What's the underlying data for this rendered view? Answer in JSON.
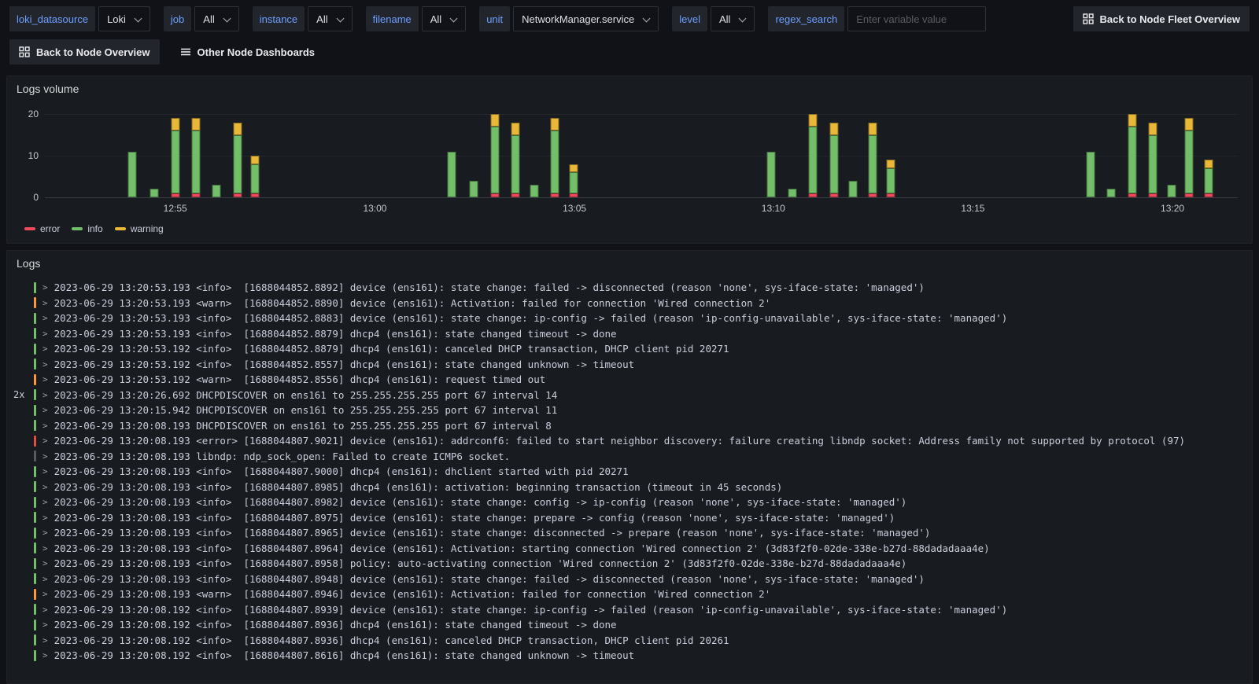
{
  "toolbar": {
    "variables": [
      {
        "label": "loki_datasource",
        "value": "Loki"
      },
      {
        "label": "job",
        "value": "All"
      },
      {
        "label": "instance",
        "value": "All"
      },
      {
        "label": "filename",
        "value": "All"
      },
      {
        "label": "unit",
        "value": "NetworkManager.service"
      },
      {
        "label": "level",
        "value": "All"
      }
    ],
    "regex_search": {
      "label": "regex_search",
      "placeholder": "Enter variable value"
    },
    "back_fleet_button": "Back to Node Fleet Overview"
  },
  "nav_row": {
    "back_node_button": "Back to Node Overview",
    "other_dashboards": "Other Node Dashboards"
  },
  "logs_volume_panel": {
    "title": "Logs volume"
  },
  "chart_data": {
    "type": "bar",
    "stacked": true,
    "title": "Logs volume",
    "ylim": [
      0,
      20
    ],
    "yticks": [
      0,
      10,
      20
    ],
    "grid": true,
    "legend_position": "bottom-left",
    "series_order": [
      "error",
      "info",
      "warning"
    ],
    "legend": [
      {
        "label": "error",
        "color": "#f2495c"
      },
      {
        "label": "info",
        "color": "#73bf69"
      },
      {
        "label": "warning",
        "color": "#eab839"
      }
    ],
    "xticks": [
      {
        "label": "12:55",
        "pos_pct": 10.93
      },
      {
        "label": "13:00",
        "pos_pct": 27.67
      },
      {
        "label": "13:05",
        "pos_pct": 44.4
      },
      {
        "label": "13:10",
        "pos_pct": 61.07
      },
      {
        "label": "13:15",
        "pos_pct": 77.8
      },
      {
        "label": "13:20",
        "pos_pct": 94.53
      }
    ],
    "bars": [
      {
        "pos_pct": 7.33,
        "error": 0,
        "info": 11,
        "warning": 0
      },
      {
        "pos_pct": 9.2,
        "error": 0,
        "info": 2,
        "warning": 0
      },
      {
        "pos_pct": 10.93,
        "error": 1,
        "info": 15,
        "warning": 3
      },
      {
        "pos_pct": 12.67,
        "error": 1,
        "info": 15,
        "warning": 3
      },
      {
        "pos_pct": 14.4,
        "error": 0,
        "info": 3,
        "warning": 0
      },
      {
        "pos_pct": 16.13,
        "error": 1,
        "info": 14,
        "warning": 3
      },
      {
        "pos_pct": 17.6,
        "error": 1,
        "info": 7,
        "warning": 2
      },
      {
        "pos_pct": 34.13,
        "error": 0,
        "info": 11,
        "warning": 0
      },
      {
        "pos_pct": 35.93,
        "error": 0,
        "info": 4,
        "warning": 0
      },
      {
        "pos_pct": 37.73,
        "error": 1,
        "info": 16,
        "warning": 3
      },
      {
        "pos_pct": 39.47,
        "error": 1,
        "info": 14,
        "warning": 3
      },
      {
        "pos_pct": 41.0,
        "error": 0,
        "info": 3,
        "warning": 0
      },
      {
        "pos_pct": 42.73,
        "error": 1,
        "info": 15,
        "warning": 3
      },
      {
        "pos_pct": 44.33,
        "error": 1,
        "info": 5,
        "warning": 2
      },
      {
        "pos_pct": 60.87,
        "error": 0,
        "info": 11,
        "warning": 0
      },
      {
        "pos_pct": 62.67,
        "error": 0,
        "info": 2,
        "warning": 0
      },
      {
        "pos_pct": 64.4,
        "error": 1,
        "info": 16,
        "warning": 3
      },
      {
        "pos_pct": 66.13,
        "error": 1,
        "info": 14,
        "warning": 3
      },
      {
        "pos_pct": 67.73,
        "error": 0,
        "info": 4,
        "warning": 0
      },
      {
        "pos_pct": 69.4,
        "error": 1,
        "info": 14,
        "warning": 3
      },
      {
        "pos_pct": 70.93,
        "error": 1,
        "info": 6,
        "warning": 2
      },
      {
        "pos_pct": 87.67,
        "error": 0,
        "info": 11,
        "warning": 0
      },
      {
        "pos_pct": 89.4,
        "error": 0,
        "info": 2,
        "warning": 0
      },
      {
        "pos_pct": 91.13,
        "error": 1,
        "info": 16,
        "warning": 3
      },
      {
        "pos_pct": 92.87,
        "error": 1,
        "info": 14,
        "warning": 3
      },
      {
        "pos_pct": 94.47,
        "error": 0,
        "info": 3,
        "warning": 0
      },
      {
        "pos_pct": 95.93,
        "error": 1,
        "info": 15,
        "warning": 3
      },
      {
        "pos_pct": 97.53,
        "error": 1,
        "info": 6,
        "warning": 2
      }
    ]
  },
  "logs_panel": {
    "title": "Logs",
    "rows": [
      {
        "count": "",
        "level": "info",
        "text": "2023-06-29 13:20:53.193 <info>  [1688044852.8892] device (ens161): state change: failed -> disconnected (reason 'none', sys-iface-state: 'managed')"
      },
      {
        "count": "",
        "level": "warn",
        "text": "2023-06-29 13:20:53.193 <warn>  [1688044852.8890] device (ens161): Activation: failed for connection 'Wired connection 2'"
      },
      {
        "count": "",
        "level": "info",
        "text": "2023-06-29 13:20:53.193 <info>  [1688044852.8883] device (ens161): state change: ip-config -> failed (reason 'ip-config-unavailable', sys-iface-state: 'managed')"
      },
      {
        "count": "",
        "level": "info",
        "text": "2023-06-29 13:20:53.193 <info>  [1688044852.8879] dhcp4 (ens161): state changed timeout -> done"
      },
      {
        "count": "",
        "level": "info",
        "text": "2023-06-29 13:20:53.192 <info>  [1688044852.8879] dhcp4 (ens161): canceled DHCP transaction, DHCP client pid 20271"
      },
      {
        "count": "",
        "level": "info",
        "text": "2023-06-29 13:20:53.192 <info>  [1688044852.8557] dhcp4 (ens161): state changed unknown -> timeout"
      },
      {
        "count": "",
        "level": "warn",
        "text": "2023-06-29 13:20:53.192 <warn>  [1688044852.8556] dhcp4 (ens161): request timed out"
      },
      {
        "count": "2x",
        "level": "info",
        "text": "2023-06-29 13:20:26.692 DHCPDISCOVER on ens161 to 255.255.255.255 port 67 interval 14"
      },
      {
        "count": "",
        "level": "info",
        "text": "2023-06-29 13:20:15.942 DHCPDISCOVER on ens161 to 255.255.255.255 port 67 interval 11"
      },
      {
        "count": "",
        "level": "info",
        "text": "2023-06-29 13:20:08.193 DHCPDISCOVER on ens161 to 255.255.255.255 port 67 interval 8"
      },
      {
        "count": "",
        "level": "error",
        "text": "2023-06-29 13:20:08.193 <error> [1688044807.9021] device (ens161): addrconf6: failed to start neighbor discovery: failure creating libndp socket: Address family not supported by protocol (97)"
      },
      {
        "count": "",
        "level": "unknown",
        "text": "2023-06-29 13:20:08.193 libndp: ndp_sock_open: Failed to create ICMP6 socket."
      },
      {
        "count": "",
        "level": "info",
        "text": "2023-06-29 13:20:08.193 <info>  [1688044807.9000] dhcp4 (ens161): dhclient started with pid 20271"
      },
      {
        "count": "",
        "level": "info",
        "text": "2023-06-29 13:20:08.193 <info>  [1688044807.8985] dhcp4 (ens161): activation: beginning transaction (timeout in 45 seconds)"
      },
      {
        "count": "",
        "level": "info",
        "text": "2023-06-29 13:20:08.193 <info>  [1688044807.8982] device (ens161): state change: config -> ip-config (reason 'none', sys-iface-state: 'managed')"
      },
      {
        "count": "",
        "level": "info",
        "text": "2023-06-29 13:20:08.193 <info>  [1688044807.8975] device (ens161): state change: prepare -> config (reason 'none', sys-iface-state: 'managed')"
      },
      {
        "count": "",
        "level": "info",
        "text": "2023-06-29 13:20:08.193 <info>  [1688044807.8965] device (ens161): state change: disconnected -> prepare (reason 'none', sys-iface-state: 'managed')"
      },
      {
        "count": "",
        "level": "info",
        "text": "2023-06-29 13:20:08.193 <info>  [1688044807.8964] device (ens161): Activation: starting connection 'Wired connection 2' (3d83f2f0-02de-338e-b27d-88dadadaaa4e)"
      },
      {
        "count": "",
        "level": "info",
        "text": "2023-06-29 13:20:08.193 <info>  [1688044807.8958] policy: auto-activating connection 'Wired connection 2' (3d83f2f0-02de-338e-b27d-88dadadaaa4e)"
      },
      {
        "count": "",
        "level": "info",
        "text": "2023-06-29 13:20:08.193 <info>  [1688044807.8948] device (ens161): state change: failed -> disconnected (reason 'none', sys-iface-state: 'managed')"
      },
      {
        "count": "",
        "level": "warn",
        "text": "2023-06-29 13:20:08.193 <warn>  [1688044807.8946] device (ens161): Activation: failed for connection 'Wired connection 2'"
      },
      {
        "count": "",
        "level": "info",
        "text": "2023-06-29 13:20:08.192 <info>  [1688044807.8939] device (ens161): state change: ip-config -> failed (reason 'ip-config-unavailable', sys-iface-state: 'managed')"
      },
      {
        "count": "",
        "level": "info",
        "text": "2023-06-29 13:20:08.192 <info>  [1688044807.8936] dhcp4 (ens161): state changed timeout -> done"
      },
      {
        "count": "",
        "level": "info",
        "text": "2023-06-29 13:20:08.192 <info>  [1688044807.8936] dhcp4 (ens161): canceled DHCP transaction, DHCP client pid 20261"
      },
      {
        "count": "",
        "level": "info",
        "text": "2023-06-29 13:20:08.192 <info>  [1688044807.8616] dhcp4 (ens161): state changed unknown -> timeout"
      }
    ]
  },
  "colors": {
    "chart_error": "#f2495c",
    "chart_info": "#73bf69",
    "chart_warning": "#eab839",
    "levels": {
      "info": "#73bf69",
      "warn": "#ff9830",
      "error": "#e24d42",
      "unknown": "#565a61"
    }
  }
}
